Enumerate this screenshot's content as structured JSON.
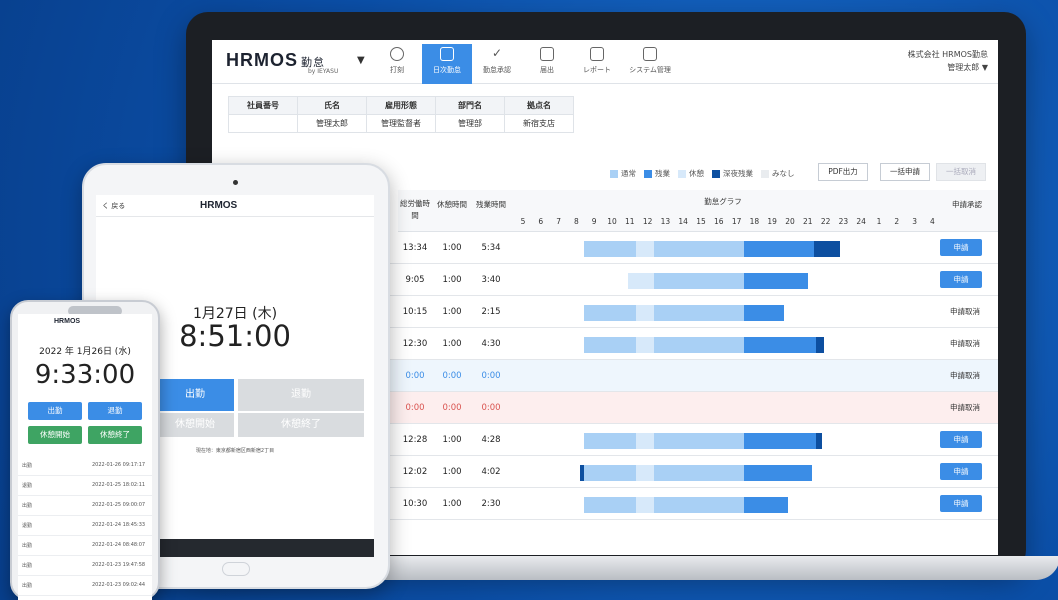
{
  "laptop": {
    "logo": "HRMOS",
    "logo_suffix": "勤怠",
    "logo_sub": "by IEYASU",
    "nav": [
      {
        "label": "打刻",
        "icon": "clock-icon"
      },
      {
        "label": "日次勤怠",
        "icon": "calendar-icon"
      },
      {
        "label": "勤怠承認",
        "icon": "check-icon"
      },
      {
        "label": "届出",
        "icon": "document-icon"
      },
      {
        "label": "レポート",
        "icon": "report-icon"
      },
      {
        "label": "システム管理",
        "icon": "monitor-icon"
      }
    ],
    "company": "株式会社 HRMOS勤怠",
    "user": "管理太郎 ▼",
    "employee_headers": [
      "社員番号",
      "氏名",
      "雇用形態",
      "部門名",
      "拠点名"
    ],
    "employee_values": [
      "",
      "管理太郎",
      "管理監督者",
      "管理部",
      "新宿支店"
    ],
    "legend": [
      {
        "label": "通常",
        "color": "#a9d0f5"
      },
      {
        "label": "残業",
        "color": "#3b8de6"
      },
      {
        "label": "休憩",
        "color": "#d7e9fa"
      },
      {
        "label": "深夜残業",
        "color": "#0d4fa0"
      },
      {
        "label": "みなし",
        "color": "#e9ecef"
      }
    ],
    "pdf_button": "PDF出力",
    "bulk_button": "一括申請",
    "bulk_cancel_button": "一括取消",
    "col_headers": {
      "work": "総労働時間",
      "break": "休憩時間",
      "overtime": "残業時間",
      "graph": "勤怠グラフ",
      "approval": "申請承認"
    },
    "hours": [
      "5",
      "6",
      "7",
      "8",
      "9",
      "10",
      "11",
      "12",
      "13",
      "14",
      "15",
      "16",
      "17",
      "18",
      "19",
      "20",
      "21",
      "22",
      "23",
      "24",
      "1",
      "2",
      "3",
      "4"
    ],
    "rows": [
      {
        "work": "13:34",
        "break": "1:00",
        "over": "5:34",
        "action": "申請",
        "status": "normal"
      },
      {
        "work": "9:05",
        "break": "1:00",
        "over": "3:40",
        "action": "申請",
        "status": "normal"
      },
      {
        "work": "10:15",
        "break": "1:00",
        "over": "2:15",
        "action": "申請取消",
        "status": "normal"
      },
      {
        "work": "12:30",
        "break": "1:00",
        "over": "4:30",
        "action": "申請取消",
        "status": "normal"
      },
      {
        "work": "0:00",
        "break": "0:00",
        "over": "0:00",
        "action": "申請取消",
        "status": "holiday-blue"
      },
      {
        "work": "0:00",
        "break": "0:00",
        "over": "0:00",
        "action": "申請取消",
        "status": "holiday-red"
      },
      {
        "work": "12:28",
        "break": "1:00",
        "over": "4:28",
        "action": "申請",
        "status": "normal"
      },
      {
        "work": "12:02",
        "break": "1:00",
        "over": "4:02",
        "action": "申請",
        "status": "normal"
      },
      {
        "work": "10:30",
        "break": "1:00",
        "over": "2:30",
        "action": "申請",
        "status": "normal"
      }
    ]
  },
  "tablet": {
    "back": "く 戻る",
    "logo": "HRMOS",
    "date": "1月27日 (木)",
    "time": "8:51:00",
    "clock_in": "出勤",
    "clock_out": "退勤",
    "break_start": "休憩開始",
    "break_end": "休憩終了",
    "location": "現在地：東京都新宿区西新宿2丁目"
  },
  "phone": {
    "logo": "HRMOS",
    "date": "2022 年 1月26日 (水)",
    "time": "9:33:00",
    "clock_in": "出勤",
    "clock_out": "退勤",
    "break_start": "休憩開始",
    "break_end": "休憩終了",
    "list": [
      {
        "label": "出勤",
        "time": "2022-01-26 09:17:17"
      },
      {
        "label": "退勤",
        "time": "2022-01-25 18:02:11"
      },
      {
        "label": "出勤",
        "time": "2022-01-25 09:00:07"
      },
      {
        "label": "退勤",
        "time": "2022-01-24 18:45:33"
      },
      {
        "label": "出勤",
        "time": "2022-01-24 08:48:07"
      },
      {
        "label": "出勤",
        "time": "2022-01-23 19:47:58"
      },
      {
        "label": "出勤",
        "time": "2022-01-23 09:02:44"
      }
    ]
  }
}
